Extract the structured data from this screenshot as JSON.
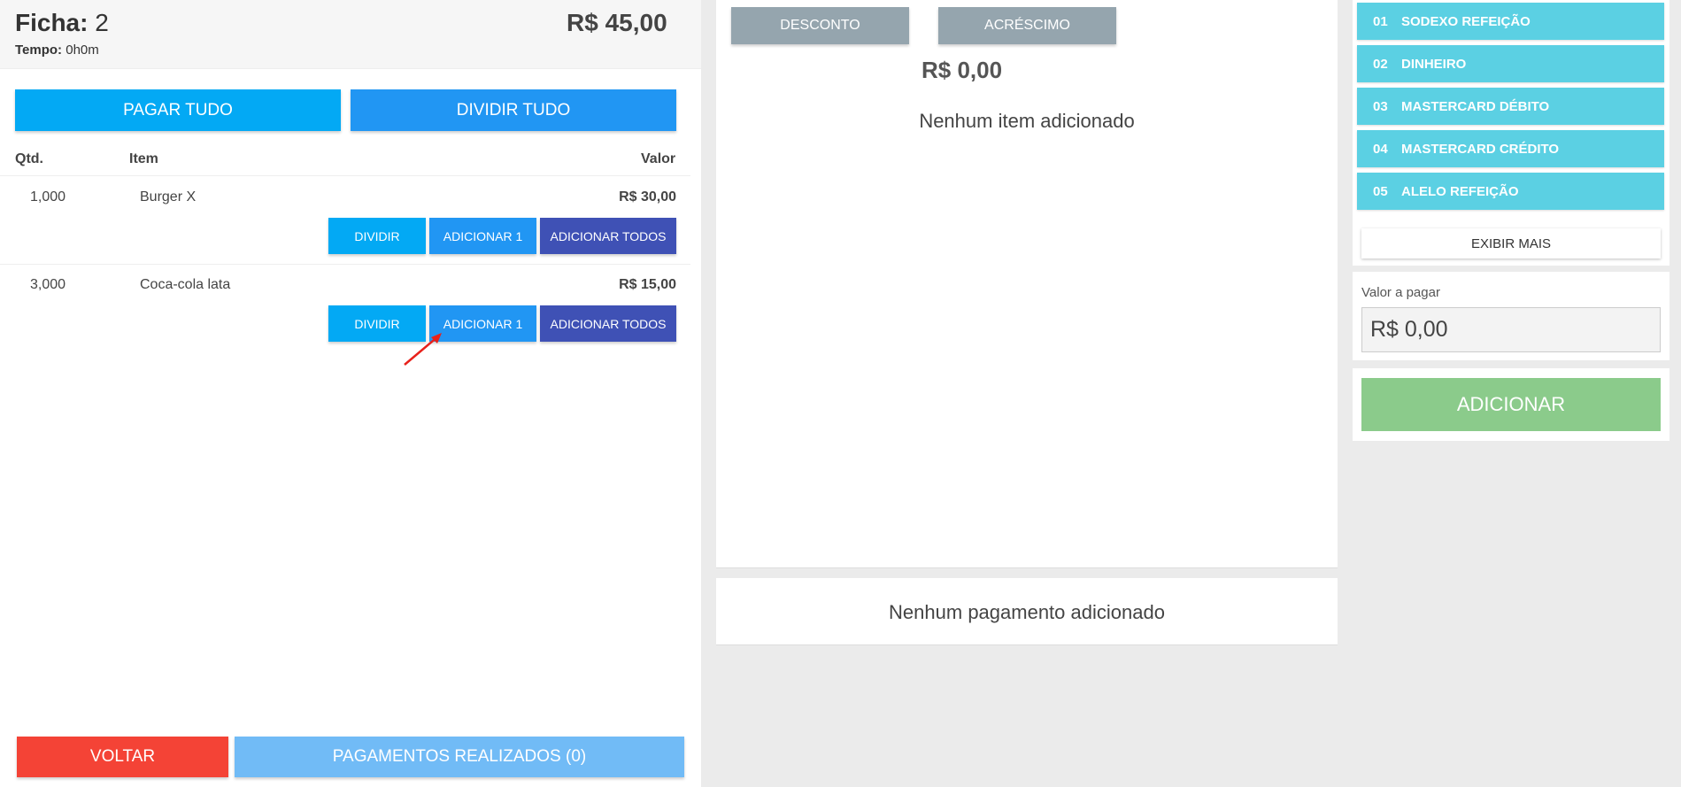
{
  "header": {
    "ficha_label": "Ficha:",
    "ficha_number": "2",
    "tempo_label": "Tempo:",
    "tempo_value": "0h0m",
    "total": "R$ 45,00"
  },
  "actions": {
    "pagar_tudo": "PAGAR TUDO",
    "dividir_tudo": "DIVIDIR TUDO"
  },
  "table": {
    "columns": [
      "Qtd.",
      "Item",
      "Valor"
    ],
    "rows": [
      {
        "qty": "1,000",
        "name": "Burger X",
        "value": "R$ 30,00"
      },
      {
        "qty": "3,000",
        "name": "Coca-cola lata",
        "value": "R$ 15,00"
      }
    ],
    "row_buttons": {
      "dividir": "DIVIDIR",
      "adicionar_1": "ADICIONAR 1",
      "adicionar_todos": "ADICIONAR TODOS"
    }
  },
  "footer": {
    "voltar": "VOLTAR",
    "pagamentos": "PAGAMENTOS REALIZADOS (0)"
  },
  "middle": {
    "desconto": "DESCONTO",
    "acrescimo": "ACRÉSCIMO",
    "value": "R$ 0,00",
    "empty_items": "Nenhum item adicionado",
    "empty_payments": "Nenhum pagamento adicionado"
  },
  "payment_methods": [
    {
      "num": "01",
      "name": "SODEXO REFEIÇÃO"
    },
    {
      "num": "02",
      "name": "DINHEIRO"
    },
    {
      "num": "03",
      "name": "MASTERCARD DÉBITO"
    },
    {
      "num": "04",
      "name": "MASTERCARD CRÉDITO"
    },
    {
      "num": "05",
      "name": "ALELO REFEIÇÃO"
    }
  ],
  "right": {
    "exibir_mais": "EXIBIR MAIS",
    "valor_label": "Valor a pagar",
    "valor_value": "R$ 0,00",
    "adicionar": "ADICIONAR"
  },
  "colors": {
    "primary_light": "#03a9f4",
    "primary": "#2196f3",
    "indigo": "#3f51b5",
    "danger": "#f44336",
    "payment": "#5bd0e3",
    "success": "#8bcb8b",
    "grey_button": "#95a5ae"
  },
  "annotation": {
    "icon": "red-arrow-icon"
  }
}
